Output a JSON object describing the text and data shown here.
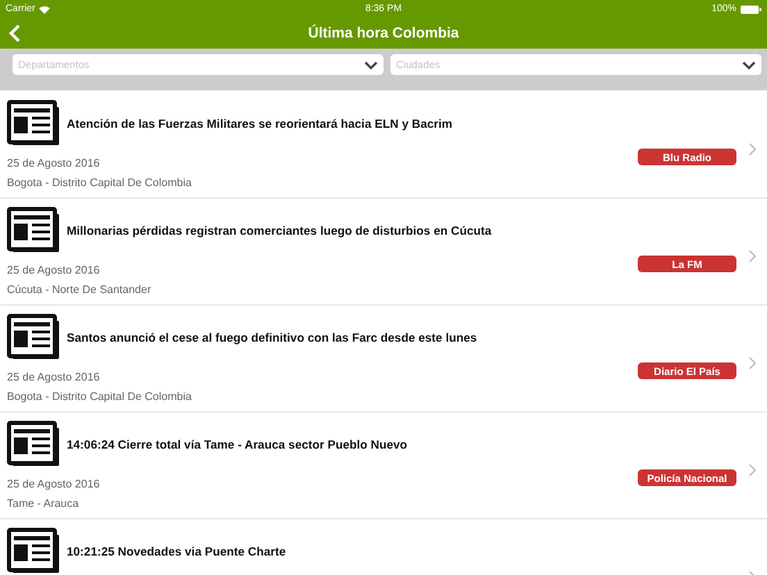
{
  "status_bar": {
    "carrier": "Carrier",
    "time": "8:36 PM",
    "battery": "100%"
  },
  "nav": {
    "title": "Última hora Colombia"
  },
  "filters": [
    {
      "placeholder": "Departamentos"
    },
    {
      "placeholder": "Ciudades"
    }
  ],
  "news": [
    {
      "title": "Atención de las Fuerzas Militares se reorientará hacia ELN y Bacrim",
      "date": "25 de Agosto 2016",
      "location": "Bogota - Distrito Capital De Colombia",
      "source": "Blu Radio"
    },
    {
      "title": "Millonarias pérdidas registran comerciantes luego de disturbios en Cúcuta",
      "date": "25 de Agosto 2016",
      "location": "Cúcuta - Norte De Santander",
      "source": "La FM"
    },
    {
      "title": "Santos anunció el cese al fuego definitivo con las Farc desde este lunes",
      "date": "25 de Agosto 2016",
      "location": "Bogota - Distrito Capital De Colombia",
      "source": "Diario El País"
    },
    {
      "title": "14:06:24 Cierre total vía Tame - Arauca sector Pueblo Nuevo",
      "date": "25 de Agosto 2016",
      "location": "Tame - Arauca",
      "source": "Policía Nacional"
    },
    {
      "title": "10:21:25 Novedades via Puente Charte"
    }
  ]
}
